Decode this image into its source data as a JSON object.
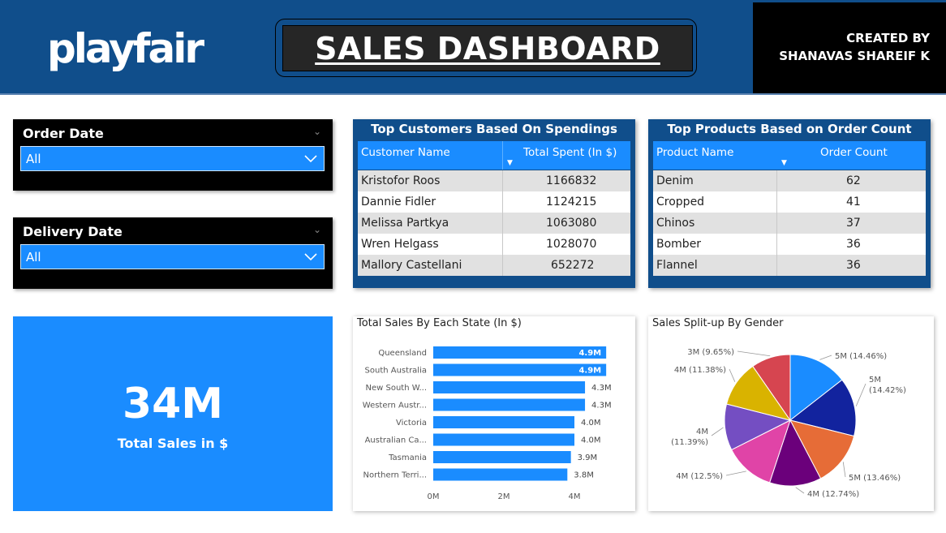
{
  "header": {
    "logo": "playfair",
    "title": "SALES DASHBOARD",
    "credit_line1": "CREATED BY",
    "credit_line2": "SHANAVAS SHAREIF K"
  },
  "slicers": [
    {
      "title": "Order Date",
      "value": "All"
    },
    {
      "title": "Delivery Date",
      "value": "All"
    }
  ],
  "kpi": {
    "value": "34M",
    "label": "Total Sales in $"
  },
  "customers_table": {
    "title": "Top Customers Based On Spendings",
    "columns": [
      "Customer Name",
      "Total Spent (In $)"
    ],
    "rows": [
      [
        "Kristofor Roos",
        "1166832"
      ],
      [
        "Dannie Fidler",
        "1124215"
      ],
      [
        "Melissa Partkya",
        "1063080"
      ],
      [
        "Wren Helgass",
        "1028070"
      ],
      [
        "Mallory Castellani",
        "652272"
      ]
    ]
  },
  "products_table": {
    "title": "Top Products Based on Order Count",
    "columns": [
      "Product Name",
      "Order Count"
    ],
    "rows": [
      [
        "Denim",
        "62"
      ],
      [
        "Cropped",
        "41"
      ],
      [
        "Chinos",
        "37"
      ],
      [
        "Bomber",
        "36"
      ],
      [
        "Flannel",
        "36"
      ]
    ]
  },
  "chart_data": [
    {
      "type": "bar",
      "title": "Total Sales By Each State (In $)",
      "orientation": "horizontal",
      "categories": [
        "Queensland",
        "South Australia",
        "New South W...",
        "Western Austr...",
        "Victoria",
        "Australian Ca...",
        "Tasmania",
        "Northern Terri..."
      ],
      "values": [
        4.9,
        4.9,
        4.3,
        4.3,
        4.0,
        4.0,
        3.9,
        3.8
      ],
      "labels": [
        "4.9M",
        "4.9M",
        "4.3M",
        "4.3M",
        "4.0M",
        "4.0M",
        "3.9M",
        "3.8M"
      ],
      "xticks": [
        "0M",
        "2M",
        "4M"
      ],
      "xlim": [
        0,
        5
      ],
      "color": "#1a8cff"
    },
    {
      "type": "pie",
      "title": "Sales Split-up By Gender",
      "slices": [
        {
          "label": "5M (14.46%)",
          "value": 14.46,
          "color": "#1a8cff"
        },
        {
          "label": "5M (14.42%)",
          "value": 14.42,
          "color": "#12239e"
        },
        {
          "label": "5M (13.46%)",
          "value": 13.46,
          "color": "#e66c37"
        },
        {
          "label": "4M (12.74%)",
          "value": 12.74,
          "color": "#6b007b"
        },
        {
          "label": "4M (12.5%)",
          "value": 12.5,
          "color": "#e044a7"
        },
        {
          "label": "4M (11.39%)",
          "value": 11.39,
          "color": "#744ec2"
        },
        {
          "label": "4M (11.38%)",
          "value": 11.38,
          "color": "#d9b300"
        },
        {
          "label": "3M (9.65%)",
          "value": 9.65,
          "color": "#d64550"
        }
      ]
    }
  ]
}
